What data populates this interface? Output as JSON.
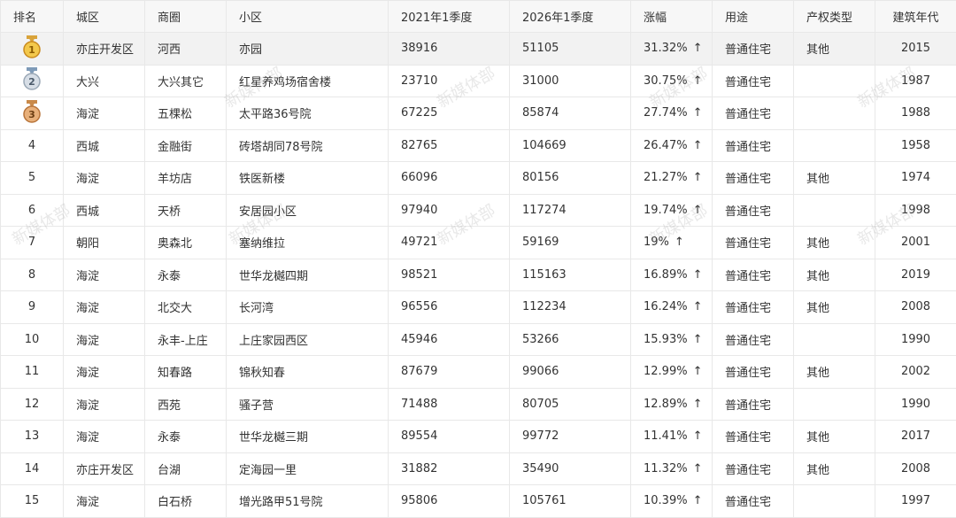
{
  "headers": [
    "排名",
    "城区",
    "商圈",
    "小区",
    "2021年1季度",
    "2026年1季度",
    "涨幅",
    "用途",
    "产权类型",
    "建筑年代"
  ],
  "watermark": "新媒体部",
  "arrow": "↑",
  "medals": [
    "1",
    "2",
    "3"
  ],
  "rows": [
    {
      "rank": "1",
      "district": "亦庄开发区",
      "area": "河西",
      "community": "亦园",
      "p2021": "38916",
      "p2026": "51105",
      "rise": "31.32%",
      "use": "普通住宅",
      "property": "其他",
      "year": "2015"
    },
    {
      "rank": "2",
      "district": "大兴",
      "area": "大兴其它",
      "community": "红星养鸡场宿舍楼",
      "p2021": "23710",
      "p2026": "31000",
      "rise": "30.75%",
      "use": "普通住宅",
      "property": "",
      "year": "1987"
    },
    {
      "rank": "3",
      "district": "海淀",
      "area": "五棵松",
      "community": "太平路36号院",
      "p2021": "67225",
      "p2026": "85874",
      "rise": "27.74%",
      "use": "普通住宅",
      "property": "",
      "year": "1988"
    },
    {
      "rank": "4",
      "district": "西城",
      "area": "金融街",
      "community": "砖塔胡同78号院",
      "p2021": "82765",
      "p2026": "104669",
      "rise": "26.47%",
      "use": "普通住宅",
      "property": "",
      "year": "1958"
    },
    {
      "rank": "5",
      "district": "海淀",
      "area": "羊坊店",
      "community": "铁医新楼",
      "p2021": "66096",
      "p2026": "80156",
      "rise": "21.27%",
      "use": "普通住宅",
      "property": "其他",
      "year": "1974"
    },
    {
      "rank": "6",
      "district": "西城",
      "area": "天桥",
      "community": "安居园小区",
      "p2021": "97940",
      "p2026": "117274",
      "rise": "19.74%",
      "use": "普通住宅",
      "property": "",
      "year": "1998"
    },
    {
      "rank": "7",
      "district": "朝阳",
      "area": "奥森北",
      "community": "塞纳维拉",
      "p2021": "49721",
      "p2026": "59169",
      "rise": "19%",
      "use": "普通住宅",
      "property": "其他",
      "year": "2001"
    },
    {
      "rank": "8",
      "district": "海淀",
      "area": "永泰",
      "community": "世华龙樾四期",
      "p2021": "98521",
      "p2026": "115163",
      "rise": "16.89%",
      "use": "普通住宅",
      "property": "其他",
      "year": "2019"
    },
    {
      "rank": "9",
      "district": "海淀",
      "area": "北交大",
      "community": "长河湾",
      "p2021": "96556",
      "p2026": "112234",
      "rise": "16.24%",
      "use": "普通住宅",
      "property": "其他",
      "year": "2008"
    },
    {
      "rank": "10",
      "district": "海淀",
      "area": "永丰-上庄",
      "community": "上庄家园西区",
      "p2021": "45946",
      "p2026": "53266",
      "rise": "15.93%",
      "use": "普通住宅",
      "property": "",
      "year": "1990"
    },
    {
      "rank": "11",
      "district": "海淀",
      "area": "知春路",
      "community": "锦秋知春",
      "p2021": "87679",
      "p2026": "99066",
      "rise": "12.99%",
      "use": "普通住宅",
      "property": "其他",
      "year": "2002"
    },
    {
      "rank": "12",
      "district": "海淀",
      "area": "西苑",
      "community": "骚子营",
      "p2021": "71488",
      "p2026": "80705",
      "rise": "12.89%",
      "use": "普通住宅",
      "property": "",
      "year": "1990"
    },
    {
      "rank": "13",
      "district": "海淀",
      "area": "永泰",
      "community": "世华龙樾三期",
      "p2021": "89554",
      "p2026": "99772",
      "rise": "11.41%",
      "use": "普通住宅",
      "property": "其他",
      "year": "2017"
    },
    {
      "rank": "14",
      "district": "亦庄开发区",
      "area": "台湖",
      "community": "定海园一里",
      "p2021": "31882",
      "p2026": "35490",
      "rise": "11.32%",
      "use": "普通住宅",
      "property": "其他",
      "year": "2008"
    },
    {
      "rank": "15",
      "district": "海淀",
      "area": "白石桥",
      "community": "增光路甲51号院",
      "p2021": "95806",
      "p2026": "105761",
      "rise": "10.39%",
      "use": "普通住宅",
      "property": "",
      "year": "1997"
    }
  ]
}
